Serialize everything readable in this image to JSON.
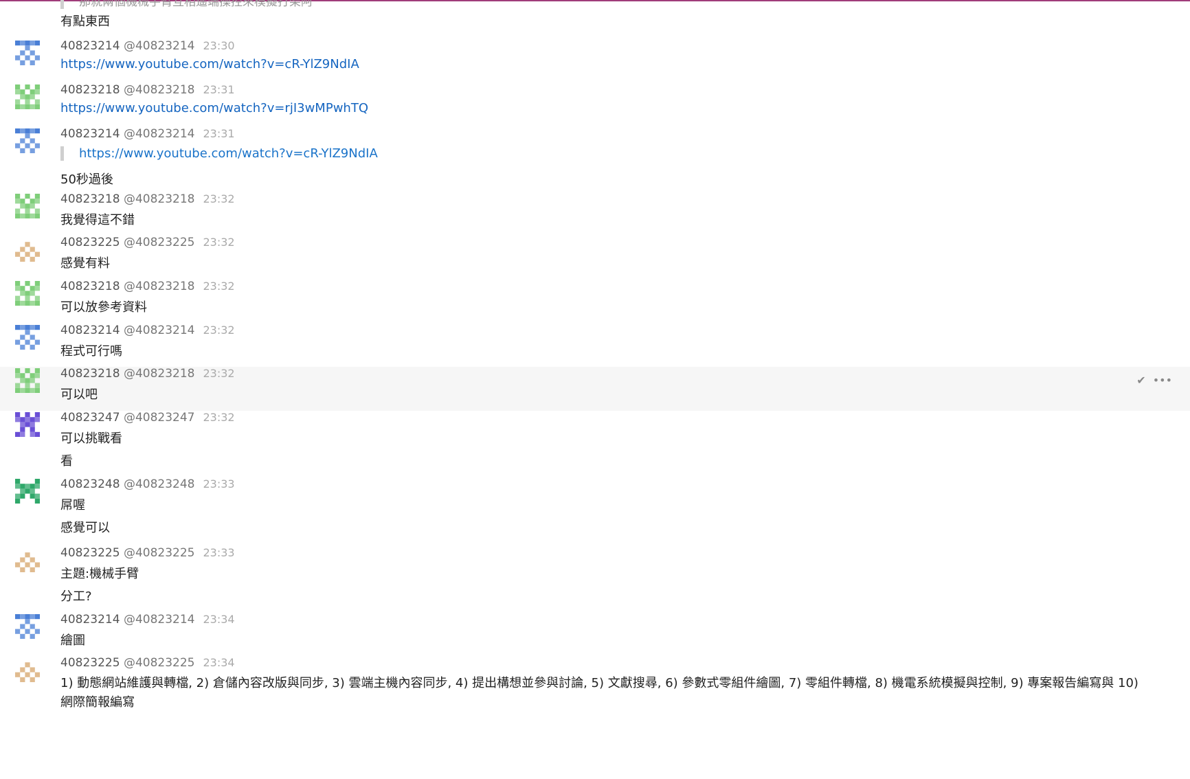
{
  "top_fragment": {
    "partial_quote": "那就兩個機械手臂互相遙端操控來模擬打架阿",
    "text": "有點東西"
  },
  "actions": {
    "check_icon": "✔",
    "more_icon": "•••"
  },
  "messages": [
    {
      "user": "40823214",
      "handle": "@40823214",
      "time": "23:30",
      "lines": [],
      "link": "https://www.youtube.com/watch?v=cR-YlZ9NdIA",
      "quote": ""
    },
    {
      "user": "40823218",
      "handle": "@40823218",
      "time": "23:31",
      "lines": [],
      "link": "https://www.youtube.com/watch?v=rjI3wMPwhTQ",
      "quote": ""
    },
    {
      "user": "40823214",
      "handle": "@40823214",
      "time": "23:31",
      "lines": [
        "50秒過後"
      ],
      "link": "",
      "quote": "https://www.youtube.com/watch?v=cR-YlZ9NdIA"
    },
    {
      "user": "40823218",
      "handle": "@40823218",
      "time": "23:32",
      "lines": [
        "我覺得這不錯"
      ],
      "link": "",
      "quote": ""
    },
    {
      "user": "40823225",
      "handle": "@40823225",
      "time": "23:32",
      "lines": [
        "感覺有料"
      ],
      "link": "",
      "quote": ""
    },
    {
      "user": "40823218",
      "handle": "@40823218",
      "time": "23:32",
      "lines": [
        "可以放參考資料"
      ],
      "link": "",
      "quote": ""
    },
    {
      "user": "40823214",
      "handle": "@40823214",
      "time": "23:32",
      "lines": [
        "程式可行嗎"
      ],
      "link": "",
      "quote": ""
    },
    {
      "user": "40823218",
      "handle": "@40823218",
      "time": "23:32",
      "lines": [
        "可以吧"
      ],
      "link": "",
      "quote": ""
    },
    {
      "user": "40823247",
      "handle": "@40823247",
      "time": "23:32",
      "lines": [
        "可以挑戰看",
        "看"
      ],
      "link": "",
      "quote": ""
    },
    {
      "user": "40823248",
      "handle": "@40823248",
      "time": "23:33",
      "lines": [
        "屌喔",
        "感覺可以"
      ],
      "link": "",
      "quote": ""
    },
    {
      "user": "40823225",
      "handle": "@40823225",
      "time": "23:33",
      "lines": [
        "主題:機械手臂",
        "分工?"
      ],
      "link": "",
      "quote": ""
    },
    {
      "user": "40823214",
      "handle": "@40823214",
      "time": "23:34",
      "lines": [
        "繪圖"
      ],
      "link": "",
      "quote": ""
    },
    {
      "user": "40823225",
      "handle": "@40823225",
      "time": "23:34",
      "lines": [
        "1) 動態網站維護與轉檔, 2) 倉儲內容改版與同步, 3) 雲端主機內容同步, 4) 提出構想並參與討論, 5) 文獻搜尋, 6) 參數式零組件繪圖, 7) 零組件轉檔, 8) 機電系統模擬與控制, 9) 專案報告編寫與 10) 網際簡報編寫"
      ],
      "link": "",
      "quote": ""
    }
  ],
  "colors": {
    "40823214": "#4a7fd6",
    "40823218": "#7fce7a",
    "40823225": "#d6a46a",
    "40823247": "#6a4fd6",
    "40823248": "#2fa86a"
  }
}
